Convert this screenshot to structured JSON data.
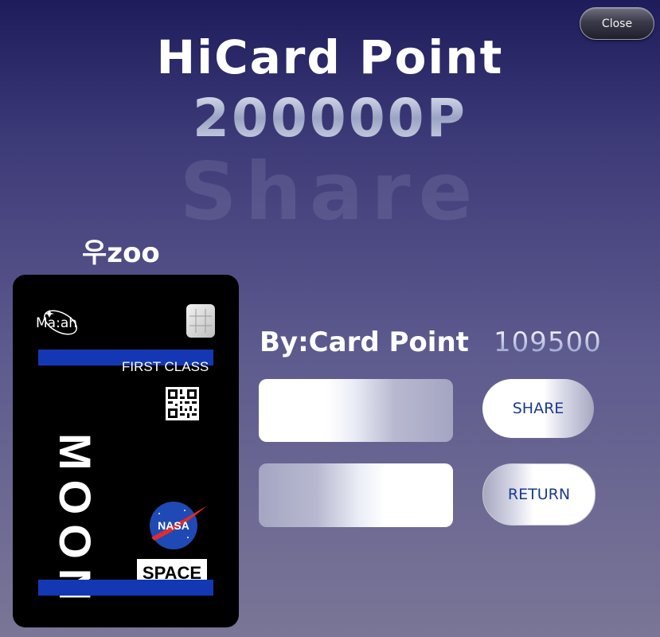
{
  "header": {
    "close_label": "Close",
    "title": "HiCard Point",
    "points": "200000P",
    "watermark": "Share"
  },
  "user": {
    "name": "우zoo"
  },
  "card": {
    "logo_text": "Ma:ah",
    "class_label": "FIRST CLASS",
    "vertical_text": "MOON",
    "badge_text": "SPACE",
    "nasa_logo_text": "NASA",
    "stripe_color": "#1438b4"
  },
  "form": {
    "by_label": "By:Card Point",
    "by_value": "109500",
    "share_label": "SHARE",
    "return_label": "RETURN"
  }
}
